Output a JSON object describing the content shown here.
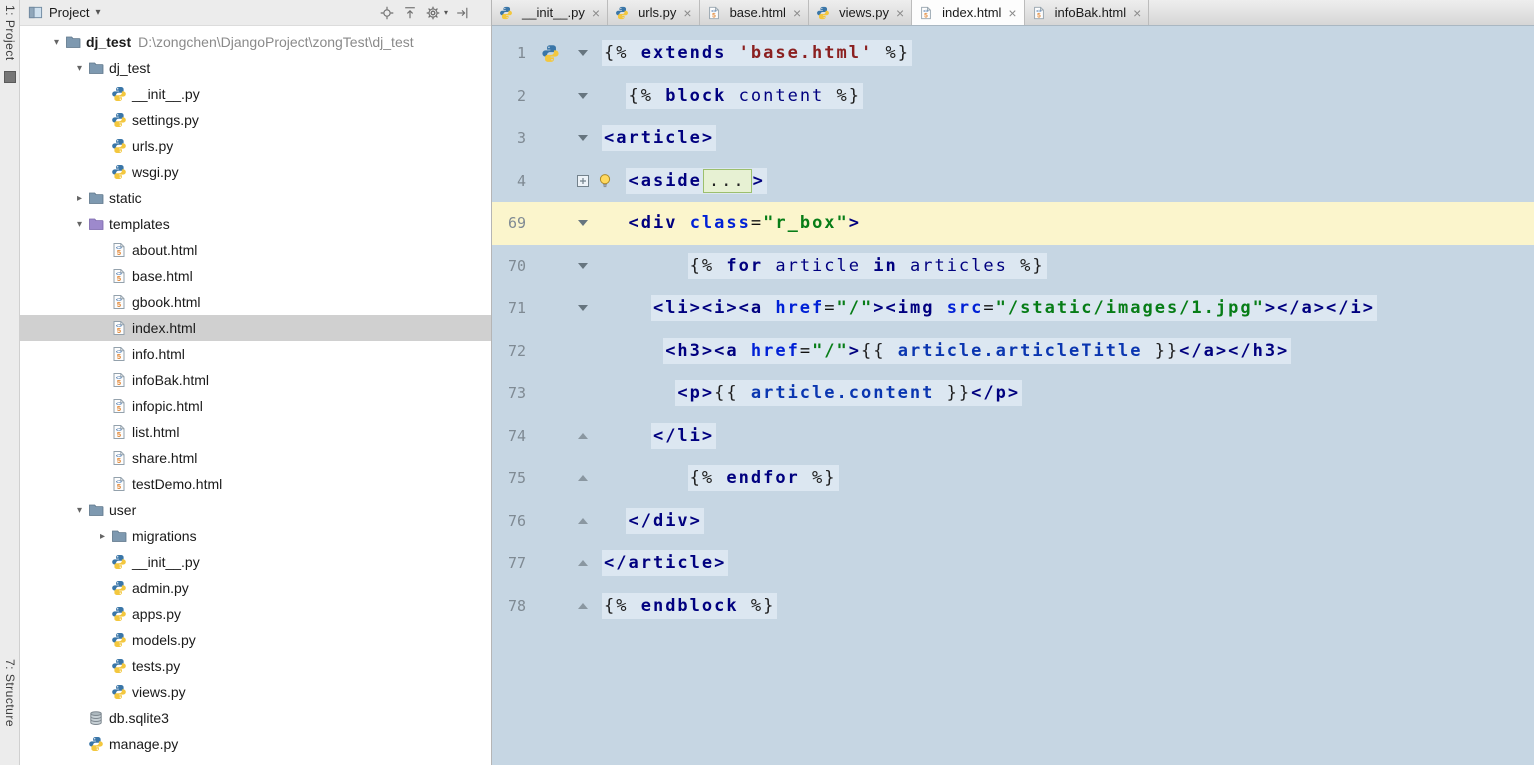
{
  "colors": {
    "editor_bg": "#c6d6e3",
    "code_strip": "#dce7f1",
    "caret_line": "#fbf5cc",
    "tree_selection": "#d0d0d0"
  },
  "activity_bar": {
    "top_button": "1: Project",
    "bottom_button": "7: Structure"
  },
  "project_panel": {
    "title": "Project",
    "header_icons": [
      "locate-icon",
      "collapse-all-icon",
      "settings-gear-icon",
      "hide-panel-icon"
    ],
    "tree": [
      {
        "label": "dj_test",
        "suffix": "D:\\zongchen\\DjangoProject\\zongTest\\dj_test",
        "icon": "folder",
        "depth": 0,
        "chevron": "down",
        "bold": true
      },
      {
        "label": "dj_test",
        "icon": "folder",
        "depth": 1,
        "chevron": "down"
      },
      {
        "label": "__init__.py",
        "icon": "python",
        "depth": 2
      },
      {
        "label": "settings.py",
        "icon": "python",
        "depth": 2
      },
      {
        "label": "urls.py",
        "icon": "python",
        "depth": 2
      },
      {
        "label": "wsgi.py",
        "icon": "python",
        "depth": 2
      },
      {
        "label": "static",
        "icon": "folder",
        "depth": 1,
        "chevron": "right"
      },
      {
        "label": "templates",
        "icon": "folder-templates",
        "depth": 1,
        "chevron": "down"
      },
      {
        "label": "about.html",
        "icon": "html",
        "depth": 2
      },
      {
        "label": "base.html",
        "icon": "html",
        "depth": 2
      },
      {
        "label": "gbook.html",
        "icon": "html",
        "depth": 2
      },
      {
        "label": "index.html",
        "icon": "html",
        "depth": 2,
        "selected": true
      },
      {
        "label": "info.html",
        "icon": "html",
        "depth": 2
      },
      {
        "label": "infoBak.html",
        "icon": "html",
        "depth": 2
      },
      {
        "label": "infopic.html",
        "icon": "html",
        "depth": 2
      },
      {
        "label": "list.html",
        "icon": "html",
        "depth": 2
      },
      {
        "label": "share.html",
        "icon": "html",
        "depth": 2
      },
      {
        "label": "testDemo.html",
        "icon": "html",
        "depth": 2
      },
      {
        "label": "user",
        "icon": "folder",
        "depth": 1,
        "chevron": "down"
      },
      {
        "label": "migrations",
        "icon": "folder",
        "depth": 2,
        "chevron": "right"
      },
      {
        "label": "__init__.py",
        "icon": "python",
        "depth": 2
      },
      {
        "label": "admin.py",
        "icon": "python",
        "depth": 2
      },
      {
        "label": "apps.py",
        "icon": "python",
        "depth": 2
      },
      {
        "label": "models.py",
        "icon": "python",
        "depth": 2
      },
      {
        "label": "tests.py",
        "icon": "python",
        "depth": 2
      },
      {
        "label": "views.py",
        "icon": "python",
        "depth": 2
      },
      {
        "label": "db.sqlite3",
        "icon": "database",
        "depth": 1
      },
      {
        "label": "manage.py",
        "icon": "python",
        "depth": 1
      }
    ]
  },
  "tabs": [
    {
      "label": "__init__.py",
      "icon": "python"
    },
    {
      "label": "urls.py",
      "icon": "python"
    },
    {
      "label": "base.html",
      "icon": "html"
    },
    {
      "label": "views.py",
      "icon": "python"
    },
    {
      "label": "index.html",
      "icon": "html",
      "active": true
    },
    {
      "label": "infoBak.html",
      "icon": "html"
    }
  ],
  "editor": {
    "file_icon": "python",
    "lines": [
      {
        "num": 1,
        "indent": 0,
        "mark": "down",
        "tokens": [
          [
            "brace",
            "{% "
          ],
          [
            "kw",
            "extends"
          ],
          [
            "plain",
            " "
          ],
          [
            "dstr",
            "'base.html'"
          ],
          [
            "brace",
            " %}"
          ]
        ]
      },
      {
        "num": 2,
        "indent": 2,
        "mark": "down",
        "tokens": [
          [
            "brace",
            "{% "
          ],
          [
            "kw",
            "block"
          ],
          [
            "plain",
            " "
          ],
          [
            "name",
            "content"
          ],
          [
            "brace",
            " %}"
          ]
        ]
      },
      {
        "num": 3,
        "indent": 0,
        "mark": "down",
        "tokens": [
          [
            "tag",
            "<article>"
          ]
        ]
      },
      {
        "num": 4,
        "indent": 2,
        "mark": "plus",
        "bulb": true,
        "tokens": [
          [
            "tag",
            "<aside"
          ],
          [
            "fold",
            "..."
          ],
          [
            "tag",
            ">"
          ]
        ]
      },
      {
        "num": 69,
        "indent": 2,
        "mark": "down",
        "caret": true,
        "tokens": [
          [
            "tag",
            "<div"
          ],
          [
            "plain",
            " "
          ],
          [
            "attr",
            "class"
          ],
          [
            "plain",
            "="
          ],
          [
            "str",
            "\"r_box\""
          ],
          [
            "tag",
            ">"
          ]
        ]
      },
      {
        "num": 70,
        "indent": 7,
        "mark": "down",
        "tokens": [
          [
            "brace",
            "{% "
          ],
          [
            "kw",
            "for"
          ],
          [
            "plain",
            " "
          ],
          [
            "name",
            "article"
          ],
          [
            "plain",
            " "
          ],
          [
            "kw",
            "in"
          ],
          [
            "plain",
            " "
          ],
          [
            "name",
            "articles"
          ],
          [
            "brace",
            " %}"
          ]
        ]
      },
      {
        "num": 71,
        "indent": 4,
        "mark": "down",
        "tokens": [
          [
            "tag",
            "<li><i><a"
          ],
          [
            "plain",
            " "
          ],
          [
            "attr",
            "href"
          ],
          [
            "plain",
            "="
          ],
          [
            "str",
            "\"/\""
          ],
          [
            "tag",
            "><img"
          ],
          [
            "plain",
            " "
          ],
          [
            "attr",
            "src"
          ],
          [
            "plain",
            "="
          ],
          [
            "str",
            "\"/static/images/1.jpg\""
          ],
          [
            "tag",
            "></a></i>"
          ]
        ]
      },
      {
        "num": 72,
        "indent": 5,
        "tokens": [
          [
            "tag",
            "<h3><a"
          ],
          [
            "plain",
            " "
          ],
          [
            "attr",
            "href"
          ],
          [
            "plain",
            "="
          ],
          [
            "str",
            "\"/\""
          ],
          [
            "tag",
            ">"
          ],
          [
            "brace",
            "{{ "
          ],
          [
            "var",
            "article.articleTitle"
          ],
          [
            "brace",
            " }}"
          ],
          [
            "tag",
            "</a></h3>"
          ]
        ]
      },
      {
        "num": 73,
        "indent": 6,
        "tokens": [
          [
            "tag",
            "<p>"
          ],
          [
            "brace",
            "{{ "
          ],
          [
            "var",
            "article.content"
          ],
          [
            "brace",
            " }}"
          ],
          [
            "tag",
            "</p>"
          ]
        ]
      },
      {
        "num": 74,
        "indent": 4,
        "mark": "up",
        "tokens": [
          [
            "tag",
            "</li>"
          ]
        ]
      },
      {
        "num": 75,
        "indent": 7,
        "mark": "up",
        "tokens": [
          [
            "brace",
            "{% "
          ],
          [
            "kw",
            "endfor"
          ],
          [
            "brace",
            " %}"
          ]
        ]
      },
      {
        "num": 76,
        "indent": 2,
        "mark": "up",
        "tokens": [
          [
            "tag",
            "</div>"
          ]
        ]
      },
      {
        "num": 77,
        "indent": 0,
        "mark": "up",
        "tokens": [
          [
            "tag",
            "</article>"
          ]
        ]
      },
      {
        "num": 78,
        "indent": 0,
        "mark": "up",
        "tokens": [
          [
            "brace",
            "{% "
          ],
          [
            "kw",
            "endblock"
          ],
          [
            "brace",
            " %}"
          ]
        ]
      }
    ]
  }
}
